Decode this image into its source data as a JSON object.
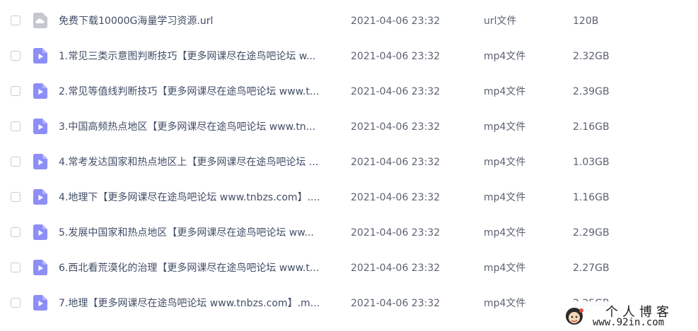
{
  "files": [
    {
      "icon": "link-file-icon",
      "name": "免费下载10000G海量学习资源.url",
      "date": "2021-04-06 23:32",
      "type": "url文件",
      "size": "120B"
    },
    {
      "icon": "video-file-icon",
      "name": "1.常见三类示意图判断技巧【更多网课尽在途鸟吧论坛 w...",
      "date": "2021-04-06 23:32",
      "type": "mp4文件",
      "size": "2.32GB"
    },
    {
      "icon": "video-file-icon",
      "name": "2.常见等值线判断技巧【更多网课尽在途鸟吧论坛 www.t...",
      "date": "2021-04-06 23:32",
      "type": "mp4文件",
      "size": "2.39GB"
    },
    {
      "icon": "video-file-icon",
      "name": "3.中国高频热点地区【更多网课尽在途鸟吧论坛 www.tn...",
      "date": "2021-04-06 23:32",
      "type": "mp4文件",
      "size": "2.16GB"
    },
    {
      "icon": "video-file-icon",
      "name": "4.常考发达国家和热点地区上【更多网课尽在途鸟吧论坛 ...",
      "date": "2021-04-06 23:32",
      "type": "mp4文件",
      "size": "1.03GB"
    },
    {
      "icon": "video-file-icon",
      "name": "4.地理下【更多网课尽在途鸟吧论坛 www.tnbzs.com】....",
      "date": "2021-04-06 23:32",
      "type": "mp4文件",
      "size": "1.16GB"
    },
    {
      "icon": "video-file-icon",
      "name": "5.发展中国家和热点地区【更多网课尽在途鸟吧论坛 ww...",
      "date": "2021-04-06 23:32",
      "type": "mp4文件",
      "size": "2.29GB"
    },
    {
      "icon": "video-file-icon",
      "name": "6.西北看荒漠化的治理【更多网课尽在途鸟吧论坛 www.t...",
      "date": "2021-04-06 23:32",
      "type": "mp4文件",
      "size": "2.27GB"
    },
    {
      "icon": "video-file-icon",
      "name": "7.地理【更多网课尽在途鸟吧论坛 www.tnbzs.com】.m...",
      "date": "2021-04-06 23:32",
      "type": "mp4文件",
      "size": "2.25GB"
    }
  ],
  "watermark": {
    "title": "个人博客",
    "url": "www.92in.com"
  },
  "colors": {
    "video_icon": "#8d8ef7",
    "link_icon": "#c4c7cf",
    "checkbox_border": "#c8ccd4"
  }
}
